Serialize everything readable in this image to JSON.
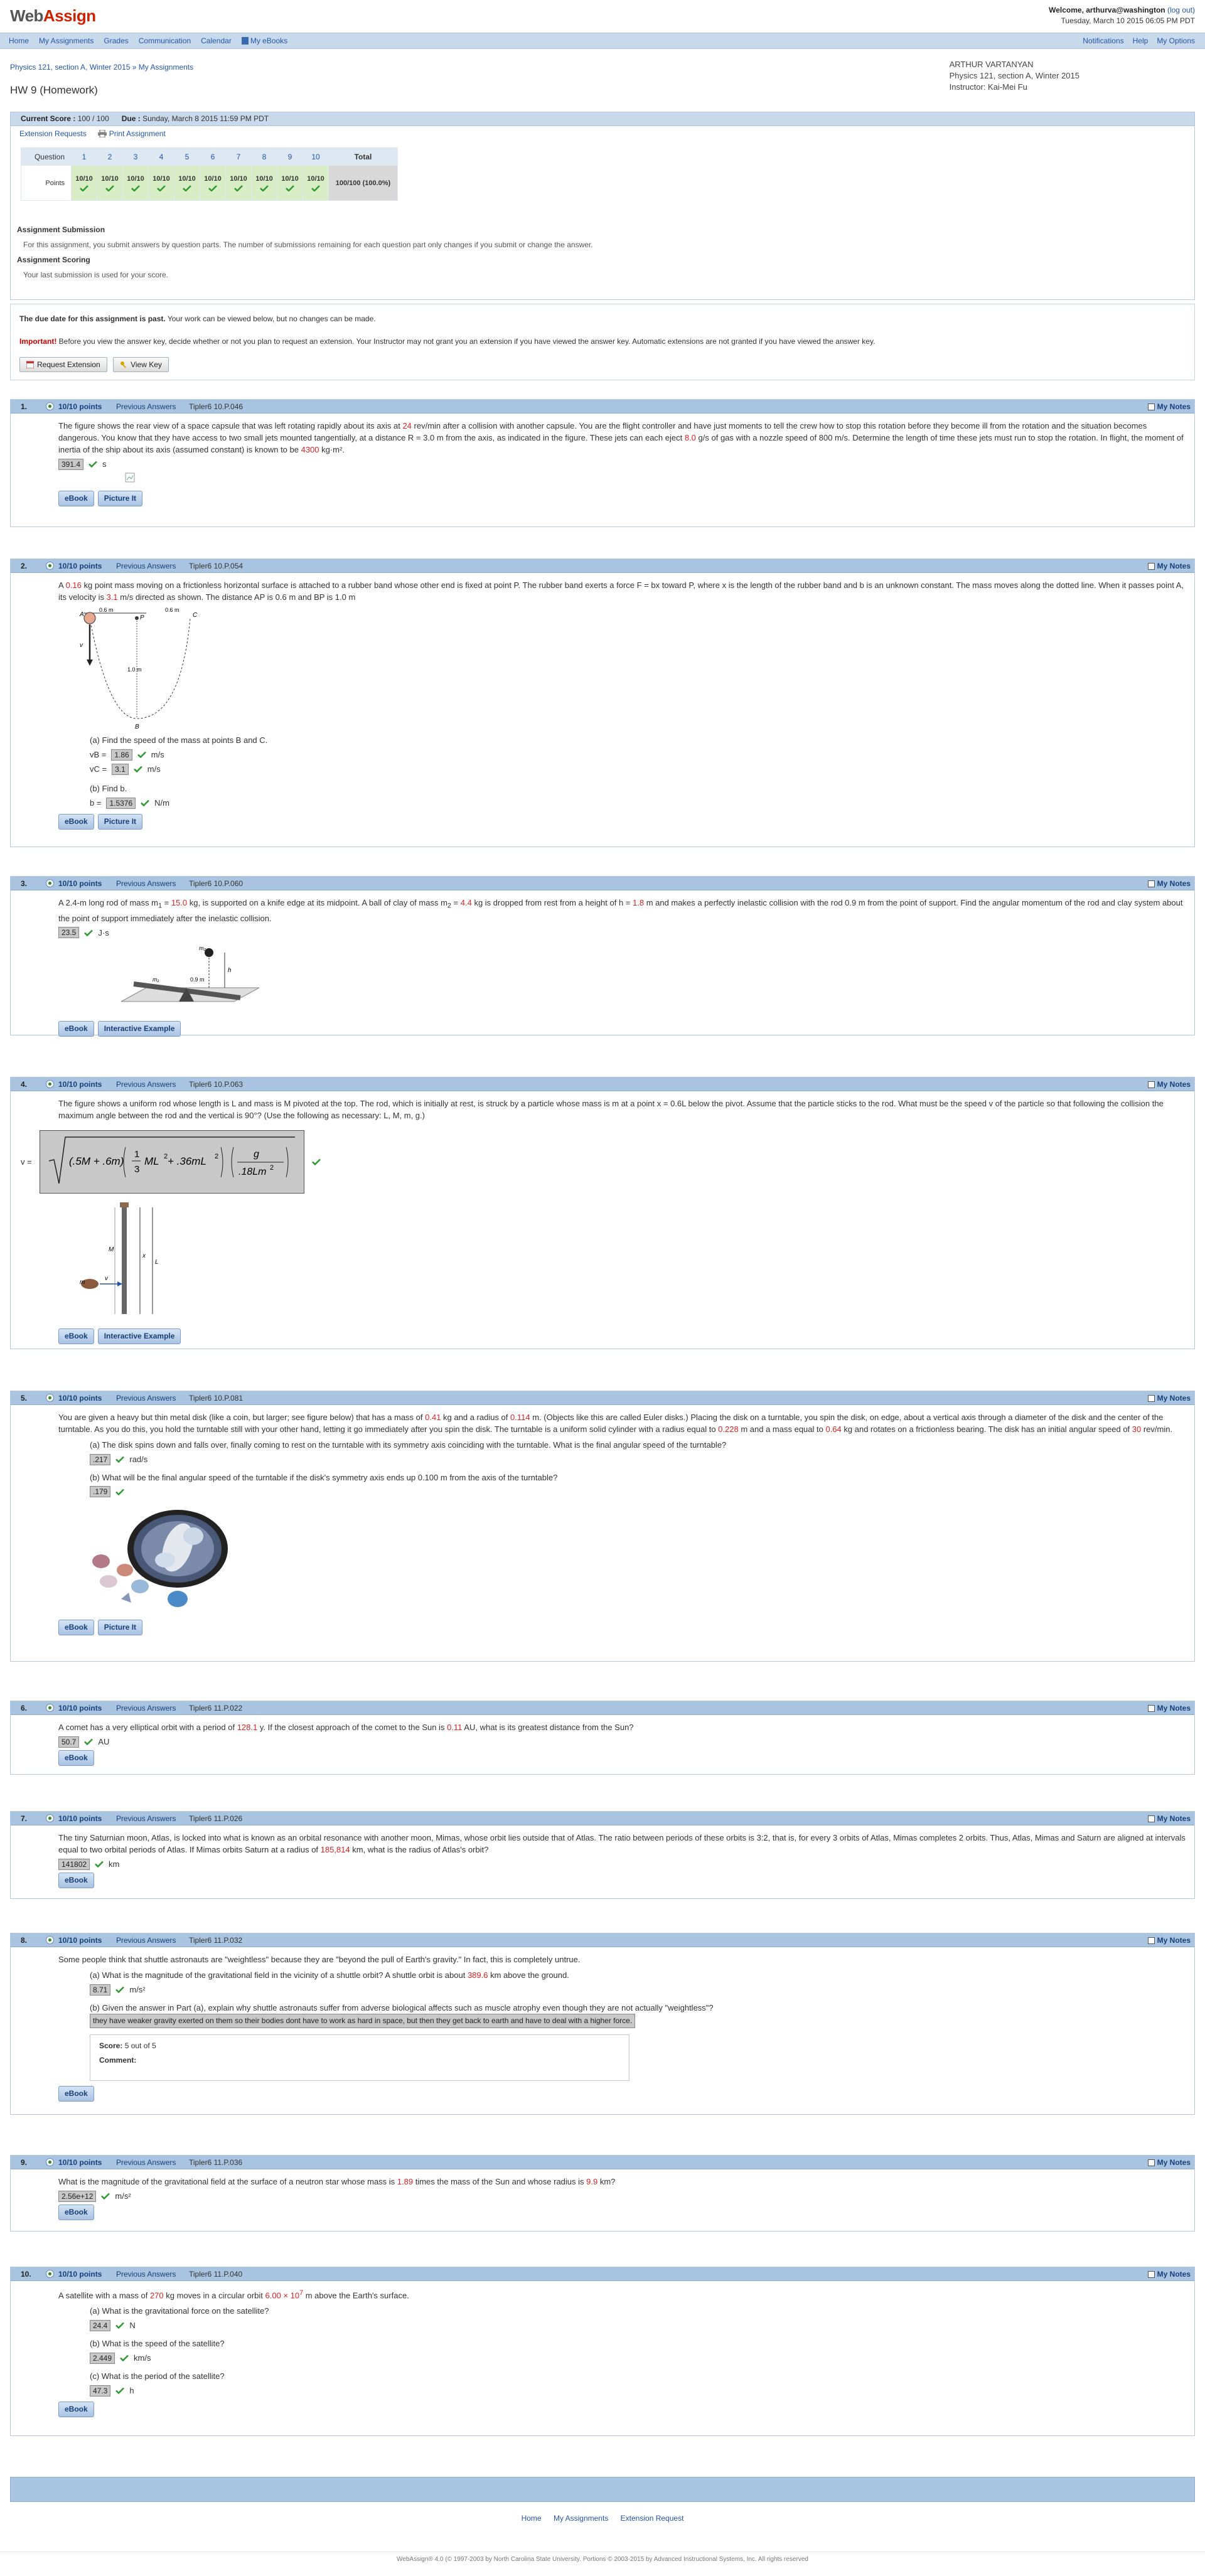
{
  "app": {
    "logo_main": "Web",
    "logo_accent": "Assign"
  },
  "user": {
    "welcome": "Welcome, arthurva@washington",
    "logout": "(log out)",
    "datetime": "Tuesday, March 10 2015 06:05 PM PDT"
  },
  "nav": {
    "left": [
      "Home",
      "My Assignments",
      "Grades",
      "Communication",
      "Calendar",
      "My eBooks"
    ],
    "right": [
      "Notifications",
      "Help",
      "My Options"
    ]
  },
  "breadcrumb": "Physics 121, section A, Winter 2015 » My Assignments",
  "page_title": "HW 9 (Homework)",
  "course_info": {
    "name": "ARTHUR VARTANYAN",
    "course": "Physics 121, section A, Winter 2015",
    "instructor": "Instructor: Kai-Mei Fu"
  },
  "summary": {
    "current_score_label": "Current Score :",
    "current_score": "100 / 100",
    "due_label": "Due :",
    "due": "Sunday, March 8 2015 11:59 PM PDT",
    "links": [
      "Extension Requests",
      "Print Assignment"
    ],
    "question_label": "Question",
    "points_label": "Points",
    "total_label": "Total",
    "questions": [
      "1",
      "2",
      "3",
      "4",
      "5",
      "6",
      "7",
      "8",
      "9",
      "10"
    ],
    "points": [
      "10/10",
      "10/10",
      "10/10",
      "10/10",
      "10/10",
      "10/10",
      "10/10",
      "10/10",
      "10/10",
      "10/10"
    ],
    "total": "100/100 (100.0%)",
    "submission_title": "Assignment Submission",
    "submission_text": "For this assignment, you submit answers by question parts. The number of submissions remaining for each question part only changes if you submit or change the answer.",
    "scoring_title": "Assignment Scoring",
    "scoring_text": "Your last submission is used for your score."
  },
  "due_notice": {
    "bold": "The due date for this assignment is past.",
    "rest": " Your work can be viewed below, but no changes can be made.",
    "important": "Important!",
    "important_text": " Before you view the answer key, decide whether or not you plan to request an extension. Your Instructor may not grant you an extension if you have viewed the answer key. Automatic extensions are not granted if you have viewed the answer key.",
    "btn_extension": "Request Extension",
    "btn_key": "View Key"
  },
  "common": {
    "points": "10/10 points",
    "prev": "Previous Answers",
    "notes": "My Notes",
    "ebook": "eBook",
    "picture": "Picture It",
    "interactive": "Interactive Example"
  },
  "questions": [
    {
      "num": "1.",
      "src": "Tipler6 10.P.046",
      "t1": "The figure shows the rear view of a space capsule that was left rotating rapidly about its axis at ",
      "v1": "24",
      "t2": " rev/min after a collision with another capsule. You are the flight controller and have just moments to tell the crew how to stop this rotation before they become ill from the rotation and the situation becomes dangerous. You know that they have access to two small jets mounted tangentially, at a distance R = 3.0 m from the axis, as indicated in the figure. These jets can each eject ",
      "v2": "8.0",
      "t3": " g/s of gas with a nozzle speed of 800 m/s. Determine the length of time these jets must run to stop the rotation. In flight, the moment of inertia of the ship about its axis (assumed constant) is known to be ",
      "v3": "4300",
      "t4": " kg·m².",
      "answer": "391.4",
      "unit": "s"
    },
    {
      "num": "2.",
      "src": "Tipler6 10.P.054",
      "t1": "A ",
      "v1": "0.16",
      "t2": " kg point mass moving on a frictionless horizontal surface is attached to a rubber band whose other end is fixed at point P. The rubber band exerts a force F = bx toward P, where x is the length of the rubber band and b is an unknown constant. The mass moves along the dotted line. When it passes point A, its velocity is ",
      "v2": "3.1",
      "t3": " m/s directed as shown. The distance AP is 0.6 m and BP is 1.0 m",
      "fig": {
        "l1": "0.6 m",
        "l2": "0.6 m",
        "l3": "1.0 m",
        "pA": "A",
        "pP": "P",
        "pB": "B",
        "pC": "C",
        "pv": "v"
      },
      "pa": "(a) Find the speed of the mass at points B and C.",
      "vb_label": "vB =",
      "vb": "1.86",
      "vc_label": "vC =",
      "vc": "3.1",
      "unit_v": "m/s",
      "pb": "(b) Find b.",
      "b_label": "b =",
      "b": "1.5376",
      "unit_b": "N/m"
    },
    {
      "num": "3.",
      "src": "Tipler6 10.P.060",
      "t1": "A 2.4-m long rod of mass m",
      "sub1": "1",
      "t1b": " = ",
      "v1": "15.0",
      "t2": " kg, is supported on a knife edge at its midpoint. A ball of clay of mass m",
      "sub2": "2",
      "t2b": " = ",
      "v2": "4.4",
      "t3": " kg is dropped from rest from a height of h = ",
      "v3": "1.8",
      "t4": " m and makes a perfectly inelastic collision with the rod 0.9 m from the point of support. Find the angular momentum of the rod and clay system about the point of support immediately after the inelastic collision.",
      "answer": "23.5",
      "unit": "J·s",
      "fig": {
        "m1": "m₁",
        "m2": "m₂",
        "d": "0.9 m",
        "h": "h"
      }
    },
    {
      "num": "4.",
      "src": "Tipler6 10.P.063",
      "text": "The figure shows a uniform rod whose length is L and mass is M pivoted at the top. The rod, which is initially at rest, is struck by a particle whose mass is m at a point x = 0.6L below the pivot. Assume that the particle sticks to the rod. What must be the speed v of the particle so that following the collision the maximum angle between the rod and the vertical is 90°? (Use the following as necessary: L, M, m, g.)",
      "v_label": "v =",
      "formula": {
        "f1": "(.5M + .6m)",
        "f2": "1",
        "f3": "3",
        "f4": "ML",
        "f5": "2",
        "f6": " + .36mL",
        "f7": "2",
        "f8": "g",
        "f9": ".18Lm",
        "f10": "2"
      },
      "fig": {
        "M": "M",
        "m": "m",
        "v": "v",
        "L": "L",
        "x": "x"
      }
    },
    {
      "num": "5.",
      "src": "Tipler6 10.P.081",
      "t1": "You are given a heavy but thin metal disk (like a coin, but larger; see figure below) that has a mass of ",
      "v1": "0.41",
      "t2": " kg and a radius of ",
      "v2": "0.114",
      "t3": " m. (Objects like this are called Euler disks.) Placing the disk on a turntable, you spin the disk, on edge, about a vertical axis through a diameter of the disk and the center of the turntable. As you do this, you hold the turntable still with your other hand, letting it go immediately after you spin the disk. The turntable is a uniform solid cylinder with a radius equal to ",
      "v3": "0.228",
      "t4": " m and a mass equal to ",
      "v4": "0.64",
      "t5": " kg and rotates on a frictionless bearing. The disk has an initial angular speed of ",
      "v5": "30",
      "t6": " rev/min.",
      "pa": "(a) The disk spins down and falls over, finally coming to rest on the turntable with its symmetry axis coinciding with the turntable. What is the final angular speed of the turntable?",
      "aa": ".217",
      "ua": "rad/s",
      "pb": "(b) What will be the final angular speed of the turntable if the disk's symmetry axis ends up 0.100 m from the axis of the turntable?",
      "ab": ".179",
      "ub": ""
    },
    {
      "num": "6.",
      "src": "Tipler6 11.P.022",
      "t1": "A comet has a very elliptical orbit with a period of ",
      "v1": "128.1",
      "t2": " y. If the closest approach of the comet to the Sun is ",
      "v2": "0.11",
      "t3": " AU, what is its greatest distance from the Sun?",
      "answer": "50.7",
      "unit": "AU"
    },
    {
      "num": "7.",
      "src": "Tipler6 11.P.026",
      "t1": "The tiny Saturnian moon, Atlas, is locked into what is known as an orbital resonance with another moon, Mimas, whose orbit lies outside that of Atlas. The ratio between periods of these orbits is 3:2, that is, for every 3 orbits of Atlas, Mimas completes 2 orbits. Thus, Atlas, Mimas and Saturn are aligned at intervals equal to two orbital periods of Atlas. If Mimas orbits Saturn at a radius of ",
      "v1": "185,814",
      "t2": " km, what is the radius of Atlas's orbit?",
      "answer": "141802",
      "unit": "km"
    },
    {
      "num": "8.",
      "src": "Tipler6 11.P.032",
      "text": "Some people think that shuttle astronauts are \"weightless\" because they are \"beyond the pull of Earth's gravity.\" In fact, this is completely untrue.",
      "pa1": "(a) What is the magnitude of the gravitational field in the vicinity of a shuttle orbit? A shuttle orbit is about ",
      "va": "389.6",
      "pa2": " km above the ground.",
      "aa": "8.71",
      "ua": "m/s²",
      "pb": "(b) Given the answer in Part (a), explain why shuttle astronauts suffer from adverse biological affects such as muscle atrophy even though they are not actually \"weightless\"?",
      "ab": "they have weaker gravity exerted on them so their bodies dont have to work as hard in space, but then they get back to earth and have to deal with a higher force.",
      "score_label": "Score:",
      "score": "5 out of 5",
      "comment_label": "Comment:"
    },
    {
      "num": "9.",
      "src": "Tipler6 11.P.036",
      "t1": "What is the magnitude of the gravitational field at the surface of a neutron star whose mass is ",
      "v1": "1.89",
      "t2": " times the mass of the Sun and whose radius is ",
      "v2": "9.9",
      "t3": " km?",
      "answer": "2.56e+12",
      "unit": "m/s²"
    },
    {
      "num": "10.",
      "src": "Tipler6 11.P.040",
      "t1": "A satellite with a mass of ",
      "v1": "270",
      "t2": " kg moves in a circular orbit ",
      "v2": "6.00 × 10",
      "exp": "7",
      "t3": " m above the Earth's surface.",
      "pa": "(a) What is the gravitational force on the satellite?",
      "aa": "24.4",
      "ua": "N",
      "pb": "(b) What is the speed of the satellite?",
      "ab": "2.449",
      "ub": "km/s",
      "pc": "(c) What is the period of the satellite?",
      "ac": "47.3",
      "uc": "h"
    }
  ],
  "footer": {
    "links": [
      "Home",
      "My Assignments",
      "Extension Request"
    ],
    "copyright": "WebAssign® 4.0 (© 1997-2003 by North Carolina State University. Portions © 2003-2015 by Advanced Instructional Systems, Inc. All rights reserved"
  },
  "colors": {
    "header_bar": "#a9c4e0",
    "nav_bar": "#c9d9ec",
    "link": "#2255aa",
    "given_value": "#dd2222",
    "correct": "#2e9a2e"
  }
}
